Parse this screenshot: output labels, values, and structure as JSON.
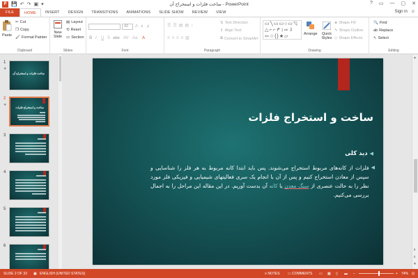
{
  "window": {
    "title": "ساخت فلزات و استخراج آن - PowerPoint",
    "buttons": [
      "?",
      "▭",
      "—",
      "▢",
      "✕"
    ]
  },
  "tabs": {
    "items": [
      "FILE",
      "HOME",
      "INSERT",
      "DESIGN",
      "TRANSITIONS",
      "ANIMATIONS",
      "SLIDE SHOW",
      "REVIEW",
      "VIEW"
    ],
    "active": "HOME",
    "signin": "Sign in"
  },
  "ribbon": {
    "clipboard": {
      "paste": "Paste",
      "cut": "Cut",
      "copy": "Copy",
      "format_painter": "Format Painter",
      "label": "Clipboard"
    },
    "slides": {
      "new_slide": "New Slide",
      "layout": "Layout",
      "reset": "Reset",
      "section": "Section",
      "label": "Slides"
    },
    "font": {
      "size": "42",
      "label": "Font",
      "format_buttons": [
        "B",
        "I",
        "U",
        "S",
        "abc",
        "AV",
        "Aa",
        "A"
      ]
    },
    "paragraph": {
      "text_direction": "Text Direction",
      "align_text": "Align Text",
      "convert": "Convert to SmartArt",
      "label": "Paragraph"
    },
    "drawing": {
      "arrange": "Arrange",
      "quick_styles": "Quick Styles",
      "shape_fill": "Shape Fill",
      "shape_outline": "Shape Outline",
      "shape_effects": "Shape Effects",
      "label": "Drawing"
    },
    "editing": {
      "find": "Find",
      "replace": "Replace",
      "select": "Select",
      "label": "Editing"
    }
  },
  "thumbnails": [
    {
      "num": "1",
      "star": "★",
      "title": "ساخت فلزات و استخراج آن",
      "selected": false
    },
    {
      "num": "2",
      "star": "★",
      "title": "ساخت و استخراج فلزات",
      "selected": true
    },
    {
      "num": "3",
      "star": "",
      "title": "",
      "selected": false
    },
    {
      "num": "4",
      "star": "",
      "title": "",
      "selected": false
    },
    {
      "num": "5",
      "star": "",
      "title": "",
      "selected": false
    },
    {
      "num": "6",
      "star": "",
      "title": "",
      "selected": false
    }
  ],
  "slide": {
    "title": "ساخت و استخراج فلزات",
    "bullet1": "دید کلی",
    "body_part1": "فلزات از کانه‌های مربوط استخراج می‌شوند. پس باید ابتدا کانه مربوط به هر فلز را شناسایی و سپس از معادن استخراج کنیم و پس از آن با انجام یک سری فعالیتهای شیمیایی و فیزیکی فلز مورد نظر را به حالت عنصری از ",
    "body_link1": "سنگ معدن",
    "body_part2": " یا ",
    "body_link2": "کانه",
    "body_part3": " آن بدست آوریم. در این مقاله این مراحل را به اجمال بررسی می‌کنیم."
  },
  "statusbar": {
    "slide_info": "SLIDE 2 OF 33",
    "language": "ENGLISH (UNITED STATES)",
    "notes": "NOTES",
    "comments": "COMMENTS",
    "zoom": "74%"
  },
  "colors": {
    "accent": "#d24726",
    "slide_bg": "#155557",
    "red_tab": "#b2261e",
    "link": "#8fd0ce"
  }
}
